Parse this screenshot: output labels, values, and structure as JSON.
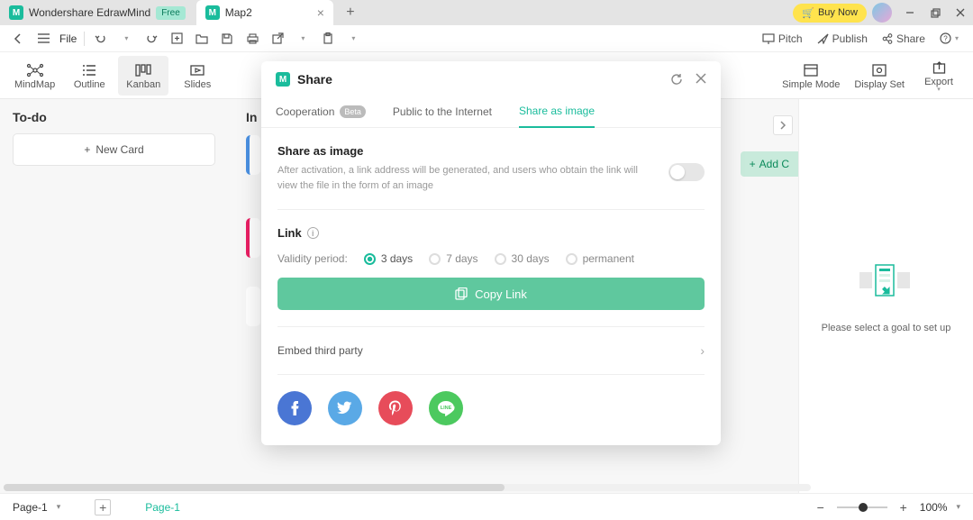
{
  "app": {
    "name": "Wondershare EdrawMind",
    "free_badge": "Free"
  },
  "tabs": [
    {
      "title": "Map2"
    }
  ],
  "buy_now": "Buy Now",
  "menu": {
    "file": "File",
    "pitch": "Pitch",
    "publish": "Publish",
    "share": "Share"
  },
  "toolbar": {
    "mindmap": "MindMap",
    "outline": "Outline",
    "kanban": "Kanban",
    "slides": "Slides",
    "simple_mode": "Simple Mode",
    "display_set": "Display Set",
    "export": "Export"
  },
  "board": {
    "col1": "To-do",
    "new_card": "New Card",
    "col2": "In p",
    "add_col": "Add C"
  },
  "right_panel": {
    "hint": "Please select a goal to set up"
  },
  "modal": {
    "title": "Share",
    "tabs": {
      "cooperation": "Cooperation",
      "beta": "Beta",
      "public": "Public to the Internet",
      "image": "Share as image"
    },
    "section_title": "Share as image",
    "desc": "After activation, a link address will be generated, and users who obtain the link will view the file in the form of an image",
    "link_label": "Link",
    "validity_label": "Validity period:",
    "periods": {
      "d3": "3 days",
      "d7": "7 days",
      "d30": "30 days",
      "perm": "permanent"
    },
    "copy": "Copy Link",
    "embed": "Embed third party"
  },
  "status": {
    "page": "Page-1",
    "page_active": "Page-1",
    "zoom": "100%"
  }
}
